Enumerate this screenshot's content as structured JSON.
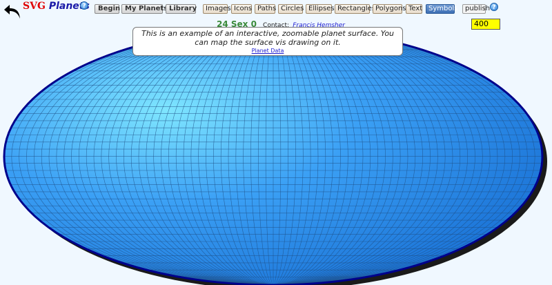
{
  "header": {
    "logo_svg": "SVG",
    "logo_planets": "Planets",
    "help_glyph": "?",
    "nav": [
      "Begin",
      "My Planets",
      "Library"
    ],
    "tools": [
      "Images",
      "Icons",
      "Paths",
      "Circles",
      "Ellipses",
      "Rectangles",
      "Polygons",
      "Text",
      "Symbols"
    ],
    "active_tool": "Symbols",
    "publish_label": "publish",
    "zoom_value": "400"
  },
  "identity": {
    "code": "24 Sex 0",
    "contact_label": "Contact:",
    "contact_name": "Francis Hemsher"
  },
  "info_box": {
    "message": "This is an example of an interactive, zoomable planet surface. You can map the surface vis drawing on it.",
    "link": "Planet Data"
  },
  "colors": {
    "planet_light": "#7fe6ff",
    "planet_mid": "#3ba0f5",
    "planet_dark": "#1a72d6",
    "rim": "#00008b",
    "grid": "#1f4f86"
  },
  "icons": [
    "back-arrow-icon",
    "help-icon"
  ]
}
